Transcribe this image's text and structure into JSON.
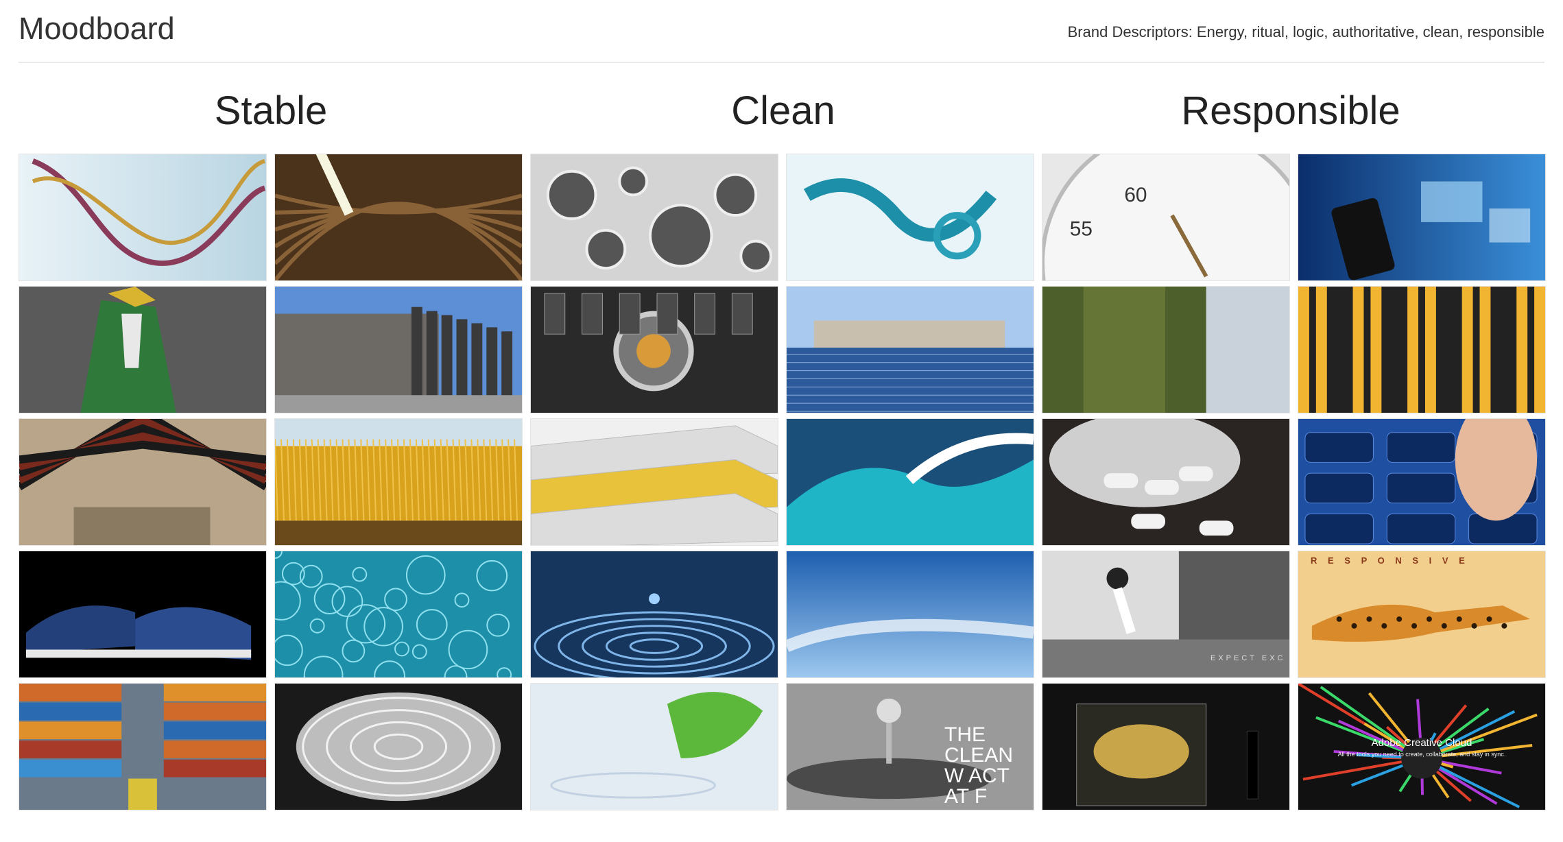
{
  "header": {
    "title": "Moodboard",
    "descriptors": "Brand Descriptors: Energy, ritual, logic, authoritative, clean, responsible"
  },
  "columns": [
    {
      "title": "Stable"
    },
    {
      "title": "Clean"
    },
    {
      "title": "Responsible"
    }
  ],
  "tiles": [
    {
      "name": "dna-helix-image",
      "color": "#cfe3ec"
    },
    {
      "name": "arched-hall-image",
      "color": "#6b4a25"
    },
    {
      "name": "water-bubbles-image",
      "color": "#bfbfbf"
    },
    {
      "name": "blue-water-splash-image",
      "color": "#2aa0b8"
    },
    {
      "name": "stopwatch-image",
      "color": "#d9d9d9"
    },
    {
      "name": "smartphone-screens-image",
      "color": "#1a5aa8"
    },
    {
      "name": "gundam-robot-image",
      "color": "#2f6b3a"
    },
    {
      "name": "concrete-pillars-image",
      "color": "#6a7d96"
    },
    {
      "name": "mechanical-engine-image",
      "color": "#3a3a3a"
    },
    {
      "name": "solar-panels-city-image",
      "color": "#2c5a9a"
    },
    {
      "name": "mossy-tree-image",
      "color": "#556b2f"
    },
    {
      "name": "yellow-stripes-image",
      "color": "#f2b531"
    },
    {
      "name": "wooden-roof-hall-image",
      "color": "#7a2a1c"
    },
    {
      "name": "wheat-field-image",
      "color": "#d9a21c"
    },
    {
      "name": "book-stack-image",
      "color": "#e8c23a"
    },
    {
      "name": "ocean-wave-image",
      "color": "#0d6f8c"
    },
    {
      "name": "white-pills-image",
      "color": "#2a2522"
    },
    {
      "name": "phone-keypad-touch-image",
      "color": "#1f4fa0"
    },
    {
      "name": "blue-sneakers-image",
      "color": "#24407a"
    },
    {
      "name": "turquoise-water-image",
      "color": "#1d8fa8"
    },
    {
      "name": "water-drop-ripple-image",
      "color": "#2c6aa8"
    },
    {
      "name": "blue-sky-clouds-image",
      "color": "#3b7fc6"
    },
    {
      "name": "tennis-player-ad-image",
      "color": "#6e6e6e",
      "caption": "EXPECT EXC"
    },
    {
      "name": "responsive-cheetah-poster-image",
      "color": "#f3cf8e",
      "caption": "R E S P O N S I V E"
    },
    {
      "name": "shipping-containers-image",
      "color": "#cf6a2a"
    },
    {
      "name": "lotus-pattern-lamp-image",
      "color": "#9a9a9a"
    },
    {
      "name": "green-leaf-water-image",
      "color": "#dfe8f2"
    },
    {
      "name": "clean-water-drop-image",
      "color": "#8a8a8a",
      "caption": "THE CLEAN W ACT AT F"
    },
    {
      "name": "museum-sculpture-image",
      "color": "#3a3326"
    },
    {
      "name": "adobe-creative-cloud-image",
      "color": "#1b1b1b",
      "caption": "Adobe Creative Cloud",
      "subcaption": "All the tools you need to create, collaborate, and stay in sync."
    }
  ]
}
